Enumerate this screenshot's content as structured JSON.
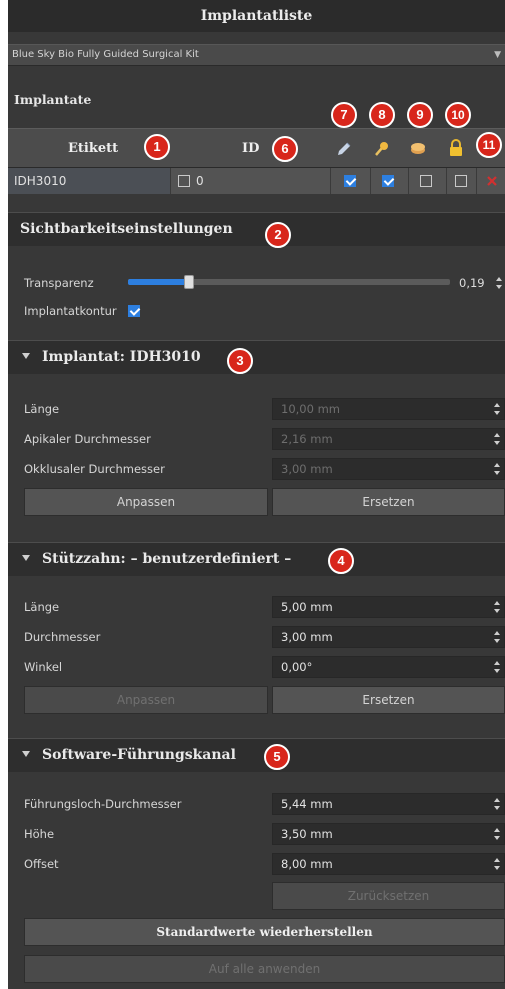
{
  "window": {
    "title": "Implantatliste"
  },
  "kit": {
    "selected": "Blue Sky Bio Fully Guided Surgical Kit"
  },
  "implants": {
    "section_label": "Implantate",
    "columns": {
      "label": "Etikett",
      "id": "ID"
    },
    "column_icons": [
      "pencil-icon",
      "pin-icon",
      "cylinder-icon",
      "lock-icon",
      "delete-icon"
    ],
    "rows": [
      {
        "label": "IDH3010",
        "id_value": "0",
        "id_checked": false,
        "col7": true,
        "col8": true,
        "col9": false,
        "col10": false
      }
    ]
  },
  "badges": [
    "1",
    "2",
    "3",
    "4",
    "5",
    "6",
    "7",
    "8",
    "9",
    "10",
    "11"
  ],
  "visibility": {
    "title": "Sichtbarkeitseinstellungen",
    "transparency_label": "Transparenz",
    "transparency_value": "0,19",
    "transparency_fraction": 0.19,
    "contour_label": "Implantatkontur",
    "contour_checked": true
  },
  "implant": {
    "title": "Implantat: IDH3010",
    "fields": [
      {
        "label": "Länge",
        "value": "10,00 mm"
      },
      {
        "label": "Apikaler Durchmesser",
        "value": "2,16 mm"
      },
      {
        "label": "Okklusaler Durchmesser",
        "value": "3,00 mm"
      }
    ],
    "adjust_label": "Anpassen",
    "replace_label": "Ersetzen"
  },
  "abutment": {
    "title": "Stützzahn: – benutzerdefiniert –",
    "fields": [
      {
        "label": "Länge",
        "value": "5,00 mm"
      },
      {
        "label": "Durchmesser",
        "value": "3,00 mm"
      },
      {
        "label": "Winkel",
        "value": "0,00°"
      }
    ],
    "adjust_label": "Anpassen",
    "replace_label": "Ersetzen"
  },
  "guide": {
    "title": "Software-Führungskanal",
    "fields": [
      {
        "label": "Führungsloch-Durchmesser",
        "value": "5,44 mm"
      },
      {
        "label": "Höhe",
        "value": "3,50 mm"
      },
      {
        "label": "Offset",
        "value": "8,00 mm"
      }
    ],
    "reset_label": "Zurücksetzen"
  },
  "footer": {
    "restore_label": "Standardwerte wiederherstellen",
    "apply_all_label": "Auf alle anwenden"
  },
  "colors": {
    "accent": "#2d7fe0",
    "badge": "#d8261b",
    "panel": "#383838",
    "header": "#2e2e2e"
  }
}
